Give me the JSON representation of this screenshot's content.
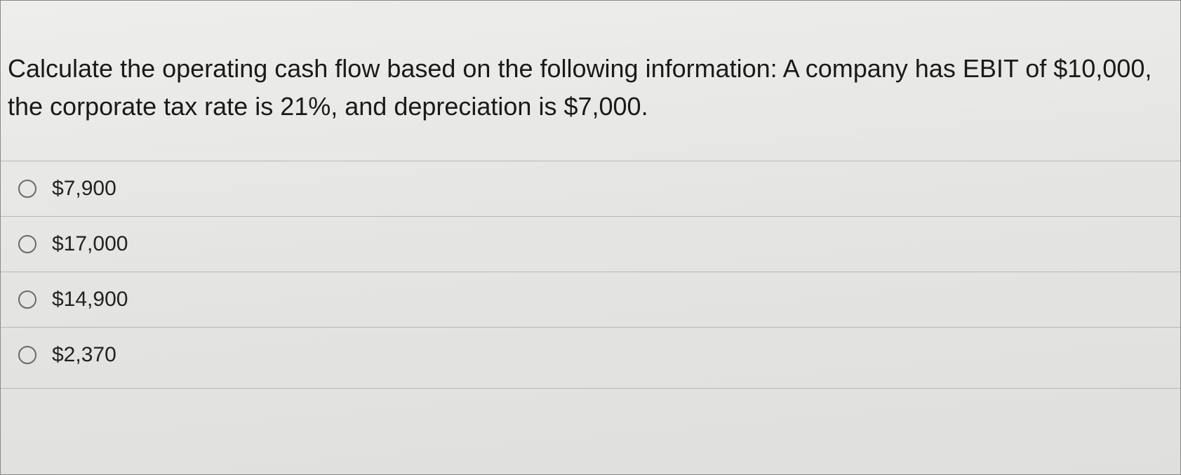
{
  "question": {
    "text": "Calculate the operating cash flow based on the following information: A company has EBIT of $10,000, the corporate tax rate is 21%, and depreciation is $7,000."
  },
  "options": [
    {
      "label": "$7,900"
    },
    {
      "label": "$17,000"
    },
    {
      "label": "$14,900"
    },
    {
      "label": "$2,370"
    }
  ]
}
